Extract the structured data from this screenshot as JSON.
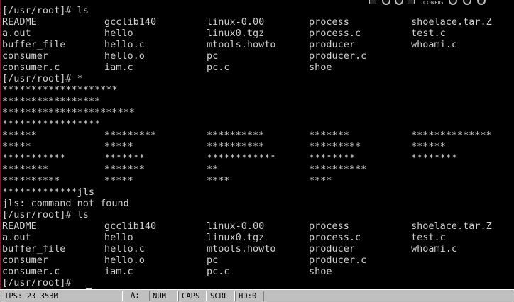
{
  "toolbar": {
    "config_label": "CONFIG"
  },
  "terminal": {
    "lines": [
      [
        "[/usr/root]# ls"
      ],
      [
        "README",
        "gcclib140",
        "linux-0.00",
        "process",
        "shoelace.tar.Z"
      ],
      [
        "a.out",
        "hello",
        "linux0.tgz",
        "process.c",
        "test.c"
      ],
      [
        "buffer_file",
        "hello.c",
        "mtools.howto",
        "producer",
        "whoami.c"
      ],
      [
        "consumer",
        "hello.o",
        "pc",
        "producer.c",
        ""
      ],
      [
        "consumer.c",
        "iam.c",
        "pc.c",
        "shoe",
        ""
      ],
      [
        "[/usr/root]# *"
      ],
      [
        "********************"
      ],
      [
        "*****************"
      ],
      [
        "***********************"
      ],
      [
        "*****************"
      ],
      [
        "******",
        "*********",
        "**********",
        "*******",
        "**************"
      ],
      [
        "*****",
        "*****",
        "**********",
        "*********",
        "******"
      ],
      [
        "***********",
        "*******",
        "************",
        "********",
        "********"
      ],
      [
        "********",
        "*******",
        "**",
        "**********",
        ""
      ],
      [
        "**********",
        "*****",
        "****",
        "****",
        ""
      ],
      [
        "*************jls"
      ],
      [
        "jls: command not found"
      ],
      [
        "[/usr/root]# ls"
      ],
      [
        "README",
        "gcclib140",
        "linux-0.00",
        "process",
        "shoelace.tar.Z"
      ],
      [
        "a.out",
        "hello",
        "linux0.tgz",
        "process.c",
        "test.c"
      ],
      [
        "buffer_file",
        "hello.c",
        "mtools.howto",
        "producer",
        "whoami.c"
      ],
      [
        "consumer",
        "hello.o",
        "pc",
        "producer.c",
        ""
      ],
      [
        "consumer.c",
        "iam.c",
        "pc.c",
        "shoe",
        ""
      ],
      [
        "[/usr/root]# "
      ]
    ]
  },
  "status_bar": {
    "ips": "IPS: 23.353M",
    "drive_a": "A:",
    "num": "NUM",
    "caps": "CAPS",
    "scrl": "SCRL",
    "hd": "HD:0"
  }
}
